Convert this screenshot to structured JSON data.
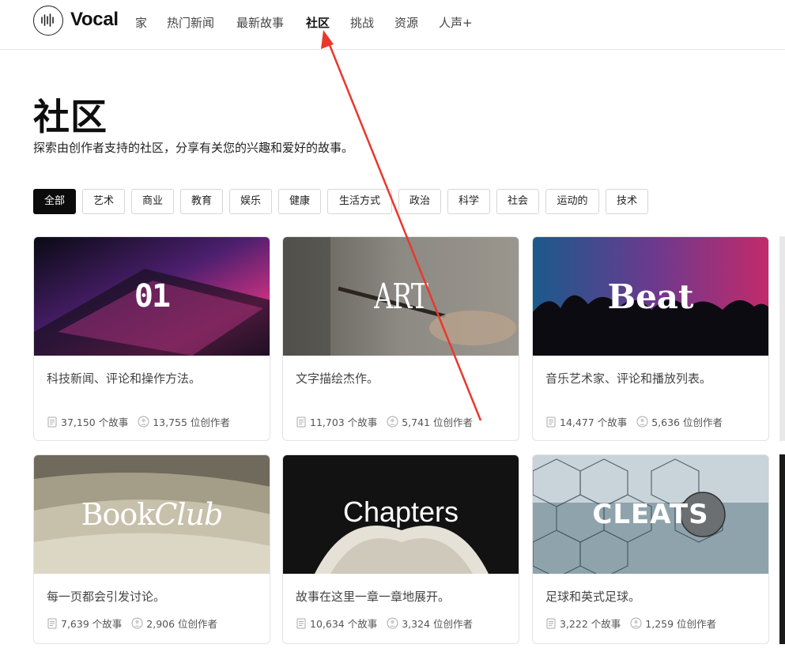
{
  "header": {
    "logo_text": "Vocal",
    "nav": [
      "家",
      "热门新闻",
      "最新故事",
      "社区",
      "挑战",
      "资源",
      "人声+"
    ]
  },
  "page": {
    "title": "社区",
    "subtitle": "探索由创作者支持的社区，分享有关您的兴趣和爱好的故事。"
  },
  "filters": [
    "全部",
    "艺术",
    "商业",
    "教育",
    "娱乐",
    "健康",
    "生活方式",
    "政治",
    "科学",
    "社会",
    "运动的",
    "技术"
  ],
  "active_filter": "全部",
  "cards": [
    {
      "banner": "01",
      "desc": "科技新闻、评论和操作方法。",
      "stories": "37,150 个故事",
      "creators": "13,755 位创作者"
    },
    {
      "banner": "ART",
      "desc": "文字描绘杰作。",
      "stories": "11,703 个故事",
      "creators": "5,741 位创作者"
    },
    {
      "banner": "Beat",
      "desc": "音乐艺术家、评论和播放列表。",
      "stories": "14,477 个故事",
      "creators": "5,636 位创作者"
    },
    {
      "banner_a": "Book",
      "banner_b": "Club",
      "desc": "每一页都会引发讨论。",
      "stories": "7,639 个故事",
      "creators": "2,906 位创作者"
    },
    {
      "banner": "Chapters",
      "desc": "故事在这里一章一章地展开。",
      "stories": "10,634 个故事",
      "creators": "3,324 位创作者"
    },
    {
      "banner": "CLEATS",
      "desc": "足球和英式足球。",
      "stories": "3,222 个故事",
      "creators": "1,259 位创作者"
    }
  ],
  "colors": {
    "annotation_arrow": "#e8382d",
    "active_chip": "#0b0b0b"
  }
}
